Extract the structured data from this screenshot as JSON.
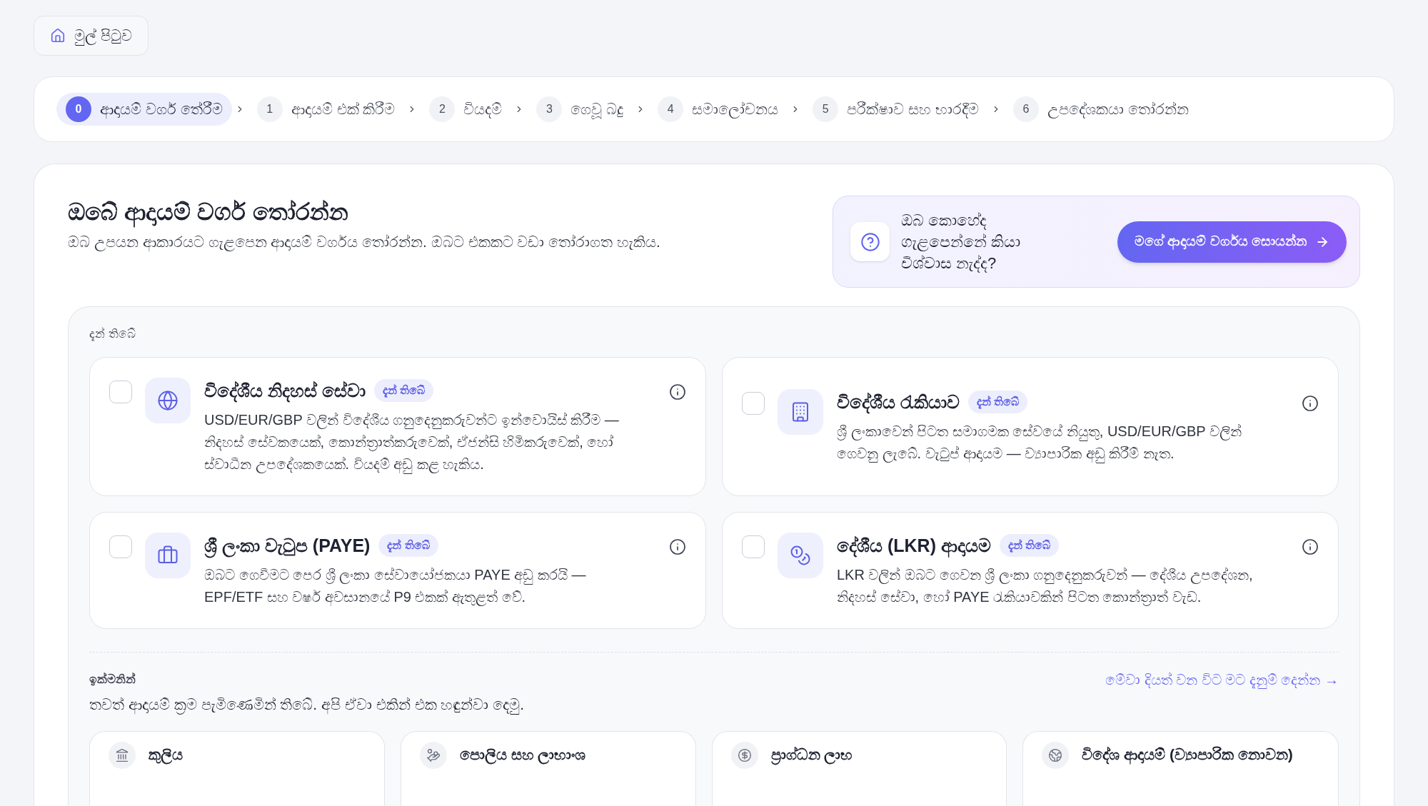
{
  "home_button": {
    "label": "මුල් පිටුව"
  },
  "steps": [
    {
      "number": "0",
      "label": "ආදායම් වර්ග තේරීම",
      "selected": true
    },
    {
      "number": "1",
      "label": "ආදායම් එක් කිරීම",
      "selected": false
    },
    {
      "number": "2",
      "label": "වියදම්",
      "selected": false
    },
    {
      "number": "3",
      "label": "ගෙවූ බදු",
      "selected": false
    },
    {
      "number": "4",
      "label": "සමාලෝචනය",
      "selected": false
    },
    {
      "number": "5",
      "label": "පරීක්ෂාව සහ භාරදීම",
      "selected": false
    },
    {
      "number": "6",
      "label": "උපදේශකයා තෝරන්න",
      "selected": false
    }
  ],
  "header": {
    "title": "ඔබේ ආදායම් වර්ග තෝරන්න",
    "subtitle": "ඔබ උපයන ආකාරයට ගැළපෙන ආදායම් වර්ගය තෝරන්න. ඔබට එකකට වඩා තෝරාගත හැකිය."
  },
  "help": {
    "text": "ඔබ කොහේද ගැළපෙන්නේ කියා විශ්වාස නැද්ද?",
    "button": "මගේ ආදායම් වර්ගය සොයන්න"
  },
  "available": {
    "heading": "දැන් තිබේ",
    "items": [
      {
        "title": "විදේශීය නිදහස් සේවා",
        "badge": "දැන් තිබේ",
        "description": "USD/EUR/GBP වලින් විදේශීය ගනුදෙනුකරුවන්ට ඉන්වොයිස් කිරීම — නිදහස් සේවකයෙක්, කොන්ත්‍රාත්කරුවෙක්, ඒජන්සි හිමිකරුවෙක්, හෝ ස්වාධීන උපදේශකයෙක්. වියදම් අඩු කළ හැකිය.",
        "checked": false
      },
      {
        "title": "විදේශීය රැකියාව",
        "badge": "දැන් තිබේ",
        "description": "ශ්‍රී ලංකාවෙන් පිටත සමාගමක සේවයේ නියුතු, USD/EUR/GBP වලින් ගෙවනු ලැබේ. වැටුප් ආදායම — ව්‍යාපාරික අඩු කිරීම් නැත.",
        "checked": false
      },
      {
        "title": "ශ්‍රී ලංකා වැටුප (PAYE)",
        "badge": "දැන් තිබේ",
        "description": "ඔබට ගෙවීමට පෙර ශ්‍රී ලංකා සේවායෝජකයා PAYE අඩු කරයි — EPF/ETF සහ වර්ෂ අවසානයේ P9 එකක් ඇතුළත් වේ.",
        "checked": false
      },
      {
        "title": "දේශීය (LKR) ආදායම",
        "badge": "දැන් තිබේ",
        "description": "LKR වලින් ඔබට ගෙවන ශ්‍රී ලංකා ගනුදෙනුකරුවන් — දේශීය උපදේශන, නිදහස් සේවා, හෝ PAYE රැකියාවකින් පිටත කොන්ත්‍රාත් වැඩ.",
        "checked": false
      }
    ]
  },
  "coming_soon": {
    "heading": "ඉක්මනින්",
    "text": "තවත් ආදායම් ක්‍රම පැමිණෙමින් තිබේ. අපි ඒවා එකින් එක හඳුන්වා දෙමු.",
    "link": "මේවා දියත් වන විට මට දැනුම් දෙන්න →",
    "items": [
      {
        "title": "කුලිය"
      },
      {
        "title": "පොලිය සහ ලාභාංශ"
      },
      {
        "title": "ප්‍රාග්ධන ලාභ"
      },
      {
        "title": "විදේශ ආදායම් (ව්‍යාපාරික නොවන)"
      }
    ]
  }
}
